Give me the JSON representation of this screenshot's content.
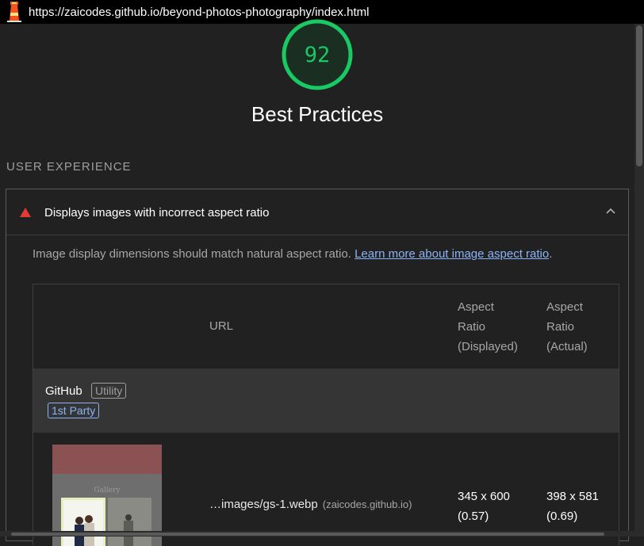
{
  "browser": {
    "url": "https://zaicodes.github.io/beyond-photos-photography/index.html"
  },
  "score": {
    "value": "92",
    "color": "#18c964"
  },
  "category": {
    "title": "Best Practices"
  },
  "group": {
    "title": "USER EXPERIENCE"
  },
  "audit": {
    "title": "Displays images with incorrect aspect ratio",
    "status_color": "#e53935",
    "description": "Image display dimensions should match natural aspect ratio. ",
    "learn_more": "Learn more about image aspect ratio",
    "description_end": ".",
    "table": {
      "headers": {
        "url": "URL",
        "displayed": [
          "Aspect",
          "Ratio",
          "(Displayed)"
        ],
        "actual": [
          "Aspect",
          "Ratio",
          "(Actual)"
        ]
      },
      "entity": {
        "name": "GitHub",
        "category_badge": "Utility",
        "party_badge": "1st Party"
      },
      "rows": [
        {
          "url": "…images/gs-1.webp",
          "origin": "(zaicodes.github.io)",
          "displayed": [
            "345 x 600",
            "(0.57)"
          ],
          "actual": [
            "398 x 581",
            "(0.69)"
          ],
          "thumbnail_title": "Gallery"
        }
      ]
    }
  }
}
